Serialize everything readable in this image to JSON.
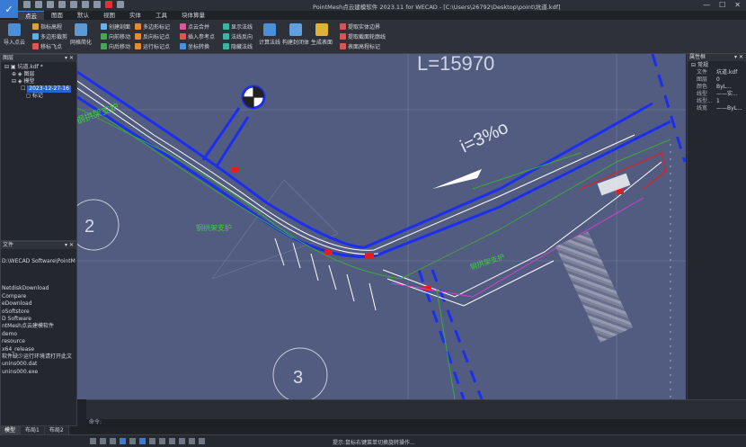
{
  "window": {
    "logo_glyph": "✓",
    "title": "PointMesh点云建模软件 2023.11 for WECAD - [C:\\Users\\26792\\Desktop\\point\\坑道.kdf]",
    "minimize": "—",
    "maximize": "☐",
    "close": "✕"
  },
  "menu": [
    "点云",
    "图面",
    "默认",
    "视图",
    "实体",
    "工具",
    "块体算量"
  ],
  "ribbon": {
    "import": "导入点云",
    "assign_elev": "指标高程",
    "multi_cut": "多边形裁剪",
    "mark_fly": "移标飞点",
    "grid_simplify": "网格简化",
    "create_section": "创建剖面",
    "move_forward": "向前移动",
    "move_backward": "向后移动",
    "poly_mark": "多边形标记",
    "reverse_mark": "反向标记点",
    "run_mark": "运行标记点",
    "cloud_merge": "点云合并",
    "insert_ref": "插入参考点",
    "coord_convert": "坐标转换",
    "show_normal": "显示法线",
    "normal_reverse": "法线反向",
    "hide_normal": "隐藏法线",
    "calc_normal": "计算法线",
    "build_surface": "构建封闭体",
    "gen_surface": "生成表面",
    "extract_solid": "提取实体边界",
    "extract_section": "提取截面轮廓线",
    "surface_mark": "表面高程标记"
  },
  "layers": {
    "title": "图层",
    "file": "坑道.kdf *",
    "items": [
      "图层",
      "模型"
    ],
    "selected": "2023-12-27-16",
    "sub": "标记"
  },
  "files": {
    "title": "文件",
    "path": "D:\\WECAD Software\\PointM",
    "items": [
      "NetdiskDownload",
      "Compare",
      "",
      "eDownload",
      "oSoftstore",
      "D Software",
      "ntMesh点云建模软件",
      "demo",
      "resource",
      "x64_release",
      "软件缺少运行环境请打开此文",
      "unins000.dat",
      "unins000.exe"
    ]
  },
  "props": {
    "title": "属性框",
    "section": "常规",
    "rows": [
      [
        "文件",
        "坑道.kdf"
      ],
      [
        "图层",
        "0"
      ],
      [
        "颜色",
        "ByL..."
      ],
      [
        "线型",
        "——实..."
      ],
      [
        "线型...",
        "1"
      ],
      [
        "线宽",
        "——ByL..."
      ]
    ]
  },
  "drawing": {
    "L_label": "L=15970",
    "slope": "i=3%o",
    "circle2": "2",
    "circle3": "3",
    "label_support1": "钢拱架支护",
    "label_support2": "钢拱架支护",
    "label_support3": "钢拱架支护",
    "label_top": "钢拱架支护"
  },
  "tabs": [
    "模型",
    "布局1",
    "布局2"
  ],
  "status": {
    "cmd_prompt": "命令:",
    "tip": "提示:鼠标右键菜单切换旋转操作..."
  },
  "colors": {
    "accent": "#3a7bd5",
    "canvas": "#525c80"
  }
}
